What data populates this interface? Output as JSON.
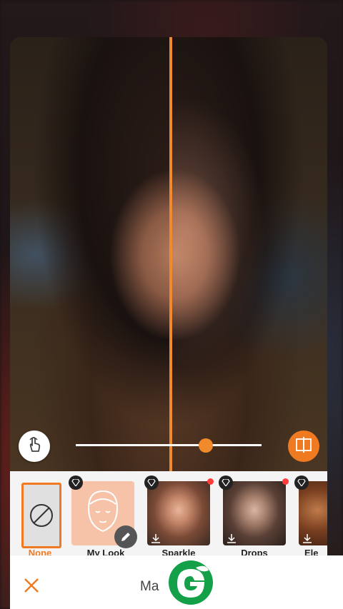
{
  "header": {
    "title": "Ma"
  },
  "compare": {
    "slider_value": 0.7
  },
  "styles": [
    {
      "label": "None",
      "selected": true,
      "premium": false,
      "new": false
    },
    {
      "label": "My Look",
      "selected": false,
      "premium": true,
      "new": false
    },
    {
      "label": "Sparkle",
      "selected": false,
      "premium": true,
      "new": true
    },
    {
      "label": "Drops",
      "selected": false,
      "premium": true,
      "new": true
    },
    {
      "label": "Ele",
      "selected": false,
      "premium": true,
      "new": false
    }
  ],
  "colors": {
    "accent": "#f07a22",
    "logo": "#13a049"
  },
  "icons": {
    "gesture": "hand-tap-icon",
    "compare": "split-compare-icon",
    "close": "close-icon",
    "edit": "pencil-icon",
    "premium": "diamond-icon",
    "download": "download-icon"
  }
}
